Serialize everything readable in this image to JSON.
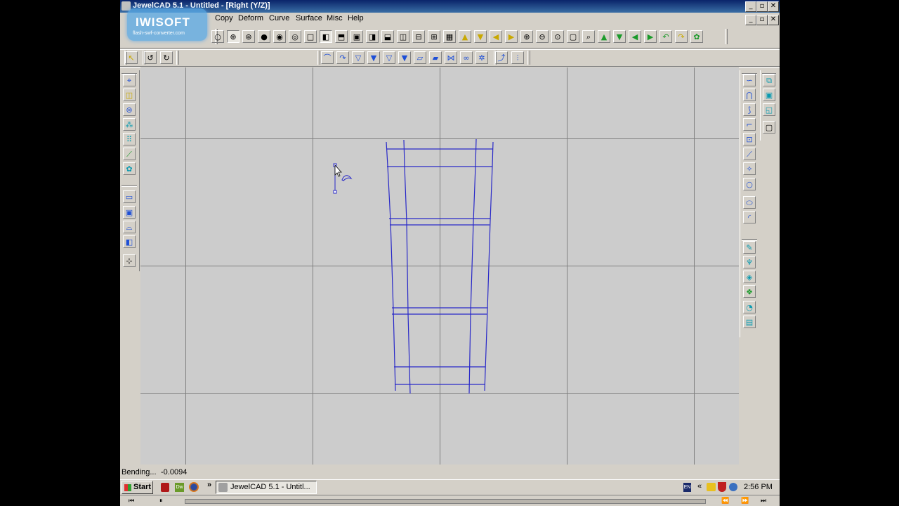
{
  "window": {
    "title": "JewelCAD 5.1 - Untitled - [Right (Y/Z)]",
    "caption_buttons": [
      "_",
      "▫",
      "✕"
    ],
    "mdi_buttons": [
      "_",
      "▫",
      "✕"
    ]
  },
  "watermark": {
    "brand": "IWISOFT",
    "sub": "flash-swf-converter.com"
  },
  "menu": [
    "Copy",
    "Deform",
    "Curve",
    "Surface",
    "Misc",
    "Help"
  ],
  "status": {
    "label": "Bending...",
    "value": "-0.0094"
  },
  "taskbar": {
    "start_label": "Start",
    "more": "»",
    "task_label": "JewelCAD 5.1 - Untitl...",
    "tray_left": "«",
    "ime": "EN",
    "clock": "2:56 PM"
  },
  "colors": {
    "curve": "#2828c8",
    "grid": "#808080",
    "viewport_bg": "#cccccc",
    "title_bar": "#0a246a"
  },
  "icons": {
    "top_toolbar": [
      "circle-outline-icon",
      "crosshair-circle-icon",
      "crosshair-filled-icon",
      "filled-circle-icon",
      "circle-dot-icon",
      "circle-arrow-icon",
      "square-icon",
      "square-left-icon",
      "square-top-icon",
      "square-thick-icon",
      "square-right-icon",
      "square-bottom-icon",
      "square-vsplit-icon",
      "square-hsplit-icon",
      "square-grid-icon",
      "square-multi-icon",
      "triangle-up-icon",
      "triangle-down-icon",
      "triangle-left-icon",
      "triangle-right-icon",
      "zoom-in-icon",
      "zoom-out-icon",
      "zoom-window-icon",
      "zoom-box-icon",
      "zoom-fit-icon",
      "arrow-up-green-icon",
      "arrow-down-green-icon",
      "arrow-left-green-icon",
      "arrow-right-green-icon",
      "rotate-left-icon",
      "rotate-right-icon",
      "render-icon"
    ],
    "second_toolbar": [
      "select-arrow-icon",
      "undo-icon",
      "redo-icon"
    ],
    "curve_toolbar": [
      "bend-curve-icon",
      "twist-curve-icon",
      "taper-down-icon",
      "taper-down-filled-icon",
      "taper-alt-icon",
      "taper-alt-filled-icon",
      "skew-icon",
      "skew-filled-icon",
      "bulge-icon",
      "wave-icon",
      "scramble-icon",
      "snap-curve-icon",
      "points-icon"
    ],
    "left_toolbar": [
      "select-points-icon",
      "mirror-icon",
      "scale-icon",
      "move-points-icon",
      "array-icon",
      "align-icon",
      "distribute-icon",
      "window-select-icon",
      "box-select-icon",
      "arch-select-icon",
      "layer-icon",
      "add-point-icon"
    ],
    "right_toolbar": [
      "free-curve-icon",
      "arc-curve-icon",
      "spline-curve-icon",
      "polyline-icon",
      "box-curve-icon",
      "line-curve-icon",
      "star-curve-icon",
      "circle-curve-icon",
      "ellipse-icon",
      "arc-icon"
    ],
    "right_toolbar_bottom": [
      "extrude-icon",
      "revolve-icon",
      "loft-icon",
      "sweep-icon",
      "sphere-icon",
      "tube-icon"
    ],
    "right_side_panel": [
      "view-copy-icon",
      "view-single-icon",
      "view-corner-icon",
      "view-disabled-icon"
    ]
  }
}
